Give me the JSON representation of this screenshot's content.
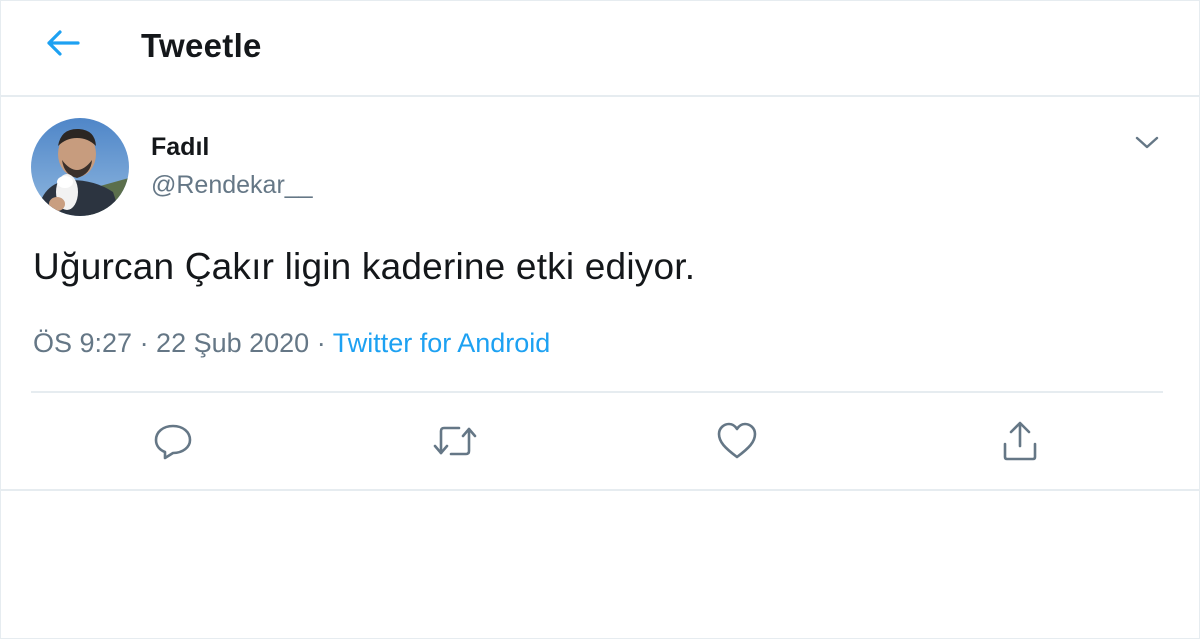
{
  "header": {
    "title": "Tweetle",
    "back_icon": "arrow-left-icon"
  },
  "tweet": {
    "author": {
      "display_name": "Fadıl",
      "handle": "@Rendekar__",
      "avatar": "profile-photo"
    },
    "text": "Uğurcan Çakır ligin kaderine etki ediyor.",
    "timestamp": "ÖS 9:27 · 22 Şub 2020",
    "separator": " · ",
    "source": "Twitter for Android",
    "menu_icon": "chevron-down-icon"
  },
  "actions": [
    {
      "name": "reply",
      "icon": "reply-icon"
    },
    {
      "name": "retweet",
      "icon": "retweet-icon"
    },
    {
      "name": "like",
      "icon": "heart-icon"
    },
    {
      "name": "share",
      "icon": "share-icon"
    }
  ],
  "colors": {
    "accent": "#1da1f2",
    "text_primary": "#14171a",
    "text_secondary": "#657786",
    "border": "#e6ecf0"
  }
}
